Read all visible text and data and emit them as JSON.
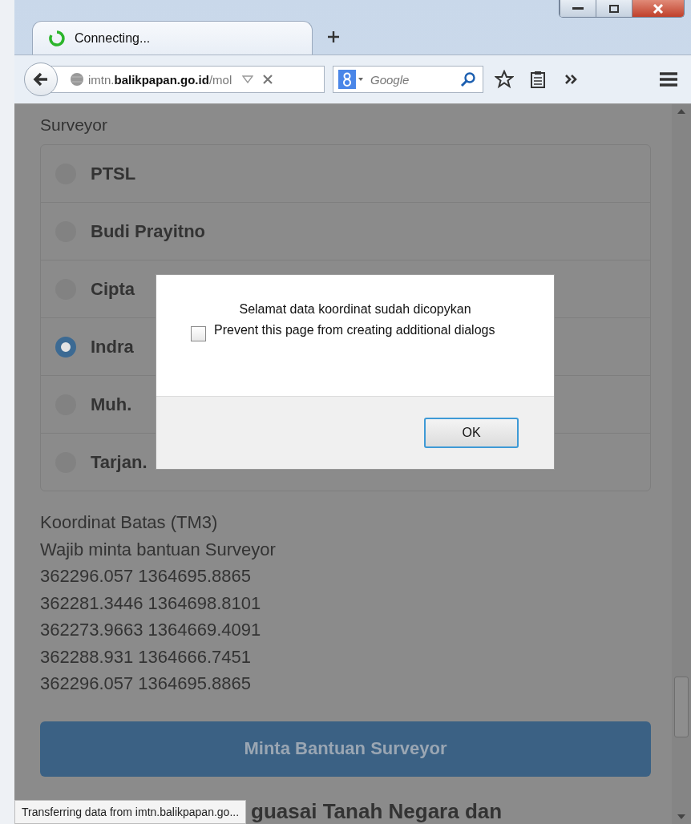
{
  "tab": {
    "title": "Connecting...",
    "loading": true
  },
  "address_bar": {
    "url": "imtn.**balikpapan.go.id**/mol"
  },
  "search": {
    "placeholder": "Google"
  },
  "page": {
    "section_label": "Surveyor",
    "surveyors": [
      {
        "name": "PTSL",
        "selected": false
      },
      {
        "name": "Budi Prayitno",
        "selected": false
      },
      {
        "name": "Cipta",
        "selected": false
      },
      {
        "name": "Indra",
        "selected": true
      },
      {
        "name": "Muh.",
        "selected": false
      },
      {
        "name": "Tarjan.",
        "selected": false
      }
    ],
    "coordinates_title": "Koordinat Batas (TM3)",
    "coordinates_note": "Wajib minta bantuan Surveyor",
    "coordinates": [
      "362296.057 1364695.8865",
      "362281.3446 1364698.8101",
      "362273.9663 1364669.4091",
      "362288.931 1364666.7451",
      "362296.057 1364695.8865"
    ],
    "request_button": "Minta Bantuan Surveyor",
    "next_heading": "guasai Tanah Negara dan"
  },
  "dialog": {
    "message": "Selamat data koordinat sudah dicopykan",
    "checkbox_label": "Prevent this page from creating additional dialogs",
    "checked": false,
    "ok_button": "OK"
  },
  "status_bar": "Transferring data from imtn.balikpapan.go..."
}
